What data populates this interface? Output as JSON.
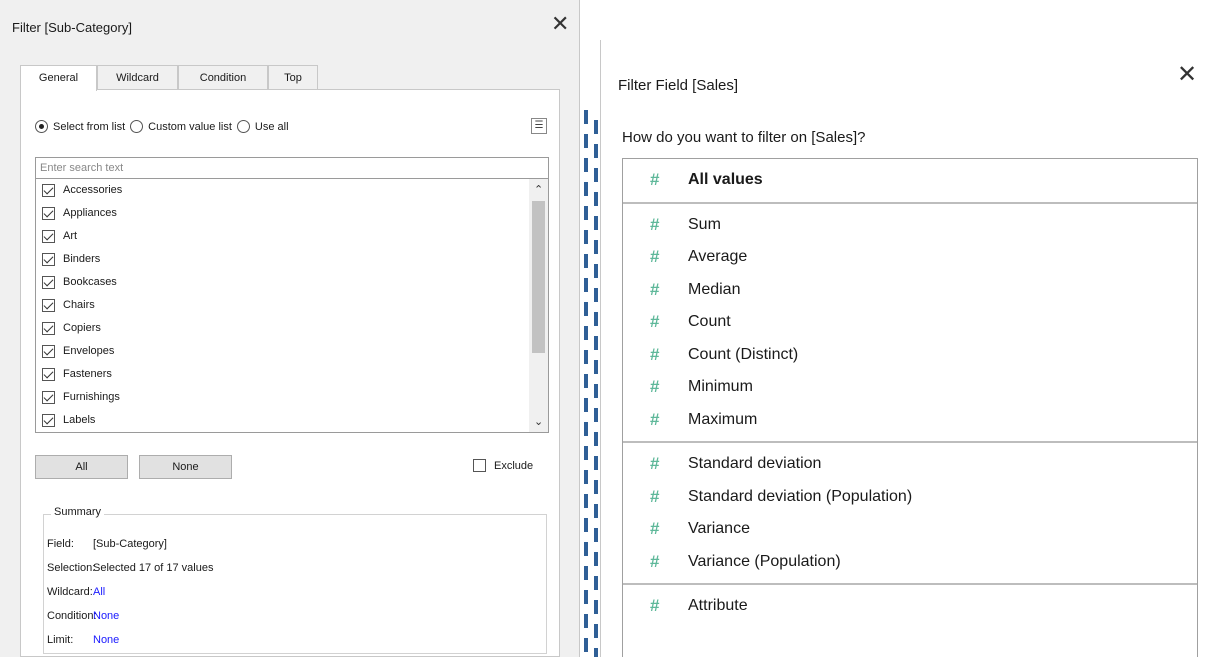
{
  "filter_dialog": {
    "title": "Filter [Sub-Category]",
    "close_glyph": "✕",
    "tabs": [
      "General",
      "Wildcard",
      "Condition",
      "Top"
    ],
    "radios": [
      {
        "label": "Select from list",
        "selected": true
      },
      {
        "label": "Custom value list",
        "selected": false
      },
      {
        "label": "Use all",
        "selected": false
      }
    ],
    "menu_glyph": "☰",
    "search_placeholder": "Enter search text",
    "items": [
      {
        "label": "Accessories",
        "checked": true
      },
      {
        "label": "Appliances",
        "checked": true
      },
      {
        "label": "Art",
        "checked": true
      },
      {
        "label": "Binders",
        "checked": true
      },
      {
        "label": "Bookcases",
        "checked": true
      },
      {
        "label": "Chairs",
        "checked": true
      },
      {
        "label": "Copiers",
        "checked": true
      },
      {
        "label": "Envelopes",
        "checked": true
      },
      {
        "label": "Fasteners",
        "checked": true
      },
      {
        "label": "Furnishings",
        "checked": true
      },
      {
        "label": "Labels",
        "checked": true
      }
    ],
    "scroll_up_glyph": "⌃",
    "scroll_down_glyph": "⌄",
    "all_button": "All",
    "none_button": "None",
    "exclude_label": "Exclude",
    "exclude_checked": false,
    "summary": {
      "legend": "Summary",
      "rows": [
        {
          "key": "Field:",
          "value": "[Sub-Category]"
        },
        {
          "key": "Selection:",
          "value": "Selected 17 of 17 values"
        },
        {
          "key": "Wildcard:",
          "value": "All"
        },
        {
          "key": "Condition:",
          "value": "None"
        },
        {
          "key": "Limit:",
          "value": "None"
        }
      ],
      "link_color": "#1a1aff"
    }
  },
  "filter_field_dialog": {
    "title": "Filter Field [Sales]",
    "close_glyph": "✕",
    "question": "How do you want to filter on [Sales]?",
    "hash_glyph": "#",
    "icon_color": "#5fb89a",
    "groups": [
      [
        "All values"
      ],
      [
        "Sum",
        "Average",
        "Median",
        "Count",
        "Count (Distinct)",
        "Minimum",
        "Maximum"
      ],
      [
        "Standard deviation",
        "Standard deviation (Population)",
        "Variance",
        "Variance (Population)"
      ],
      [
        "Attribute"
      ]
    ]
  }
}
